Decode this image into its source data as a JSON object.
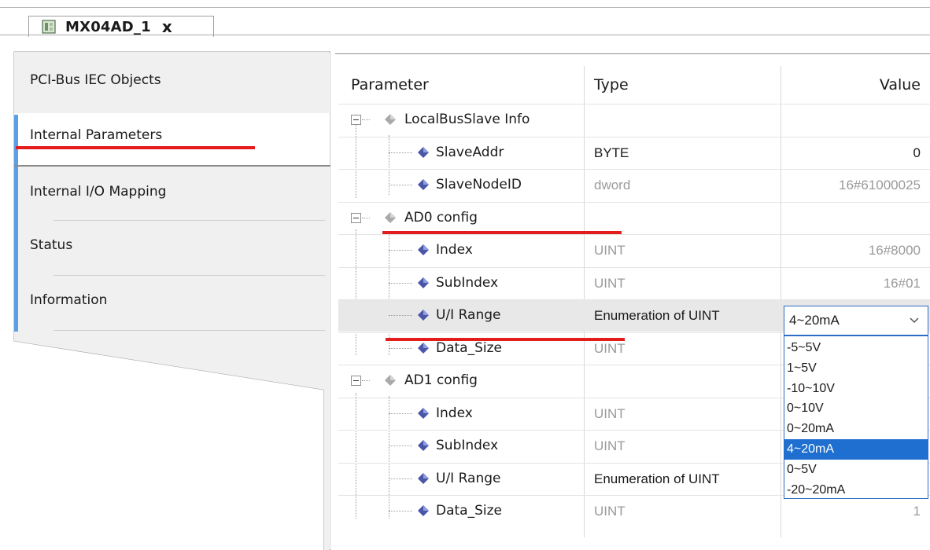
{
  "tab": {
    "title": "MX04AD_1",
    "close": "x",
    "icon": "device-icon"
  },
  "sidebar": {
    "items": [
      {
        "label": "PCI-Bus IEC Objects"
      },
      {
        "label": "Internal Parameters"
      },
      {
        "label": "Internal I/O Mapping"
      },
      {
        "label": "Status"
      },
      {
        "label": "Information"
      }
    ]
  },
  "grid": {
    "headers": {
      "param": "Parameter",
      "type": "Type",
      "value": "Value"
    },
    "rows": [
      {
        "param": "LocalBusSlave Info",
        "type": "",
        "value": ""
      },
      {
        "param": "SlaveAddr",
        "type": "BYTE",
        "value": "0"
      },
      {
        "param": "SlaveNodeID",
        "type": "dword",
        "value": "16#61000025"
      },
      {
        "param": "AD0 config",
        "type": "",
        "value": ""
      },
      {
        "param": "Index",
        "type": "UINT",
        "value": "16#8000"
      },
      {
        "param": "SubIndex",
        "type": "UINT",
        "value": "16#01"
      },
      {
        "param": "U/I Range",
        "type": "Enumeration of UINT",
        "value": "4~20mA"
      },
      {
        "param": "Data_Size",
        "type": "UINT",
        "value": ""
      },
      {
        "param": "AD1 config",
        "type": "",
        "value": ""
      },
      {
        "param": "Index",
        "type": "UINT",
        "value": ""
      },
      {
        "param": "SubIndex",
        "type": "UINT",
        "value": ""
      },
      {
        "param": "U/I Range",
        "type": "Enumeration of UINT",
        "value": ""
      },
      {
        "param": "Data_Size",
        "type": "UINT",
        "value": "1"
      }
    ]
  },
  "dropdown": {
    "selected": "4~20mA",
    "options": [
      "-5~5V",
      "1~5V",
      "-10~10V",
      "0~10V",
      "0~20mA",
      "4~20mA",
      "0~5V",
      "-20~20mA"
    ]
  },
  "colors": {
    "accent": "#5aa0e6",
    "selection": "#1e6fd0",
    "highlight": "#e51c1c"
  }
}
